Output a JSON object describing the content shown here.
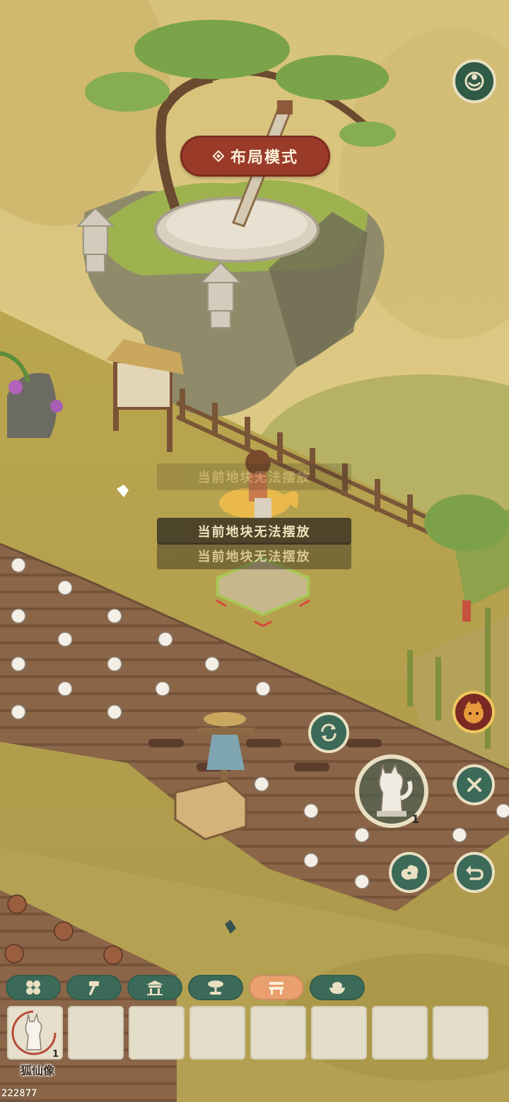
{
  "mode_banner": {
    "label": "布局模式",
    "icon": "diamond-icon"
  },
  "toasts": [
    "当前地块无法摆放",
    "当前地块无法摆放",
    "当前地块无法摆放"
  ],
  "buttons": {
    "top_right": "teacup-icon",
    "rotate": "rotate-icon",
    "close": "close-icon",
    "cloud": "cloud-swirl-icon",
    "undo": "undo-icon",
    "character": "fox-avatar-icon"
  },
  "placing_item": {
    "name": "狐仙像",
    "count": "1"
  },
  "category_tabs": [
    {
      "icon": "grid-icon",
      "active": false
    },
    {
      "icon": "hammer-icon",
      "active": false
    },
    {
      "icon": "shrine-icon",
      "active": false
    },
    {
      "icon": "bonsai-tree-icon",
      "active": false
    },
    {
      "icon": "bench-icon",
      "active": true
    },
    {
      "icon": "bowl-icon",
      "active": false
    }
  ],
  "inventory": [
    {
      "name": "狐仙像",
      "count": "1"
    },
    {
      "name": "",
      "count": ""
    },
    {
      "name": "",
      "count": ""
    },
    {
      "name": "",
      "count": ""
    },
    {
      "name": "",
      "count": ""
    },
    {
      "name": "",
      "count": ""
    },
    {
      "name": "",
      "count": ""
    },
    {
      "name": "",
      "count": ""
    }
  ],
  "build_id": "222877",
  "colors": {
    "accent_red": "#9a3b2a",
    "button_green": "#3b6a58",
    "tab_active": "#e9a06e",
    "slot_bg": "#e3ddc9"
  }
}
